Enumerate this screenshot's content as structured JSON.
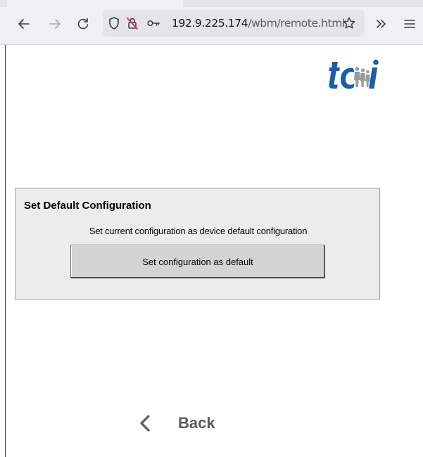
{
  "browser": {
    "url_host": "192.9.225.174",
    "url_path": "/wbm/remote.html",
    "icons": {
      "back": "arrow-left-icon",
      "forward": "arrow-right-icon",
      "reload": "reload-icon",
      "tracking_protection": "shield-icon",
      "connection": "insecure-lock-icon",
      "permissions": "key-icon",
      "bookmark": "star-icon",
      "overflow": "double-chevron-icon",
      "menu": "hamburger-menu-icon"
    }
  },
  "logo": {
    "name": "tci-logo",
    "color": "#1a5fae"
  },
  "panel": {
    "title": "Set Default Configuration",
    "description": "Set current configuration as device default configuration",
    "button_label": "Set configuration as default"
  },
  "footer": {
    "back_label": "Back",
    "back_icon": "chevron-left-icon"
  }
}
